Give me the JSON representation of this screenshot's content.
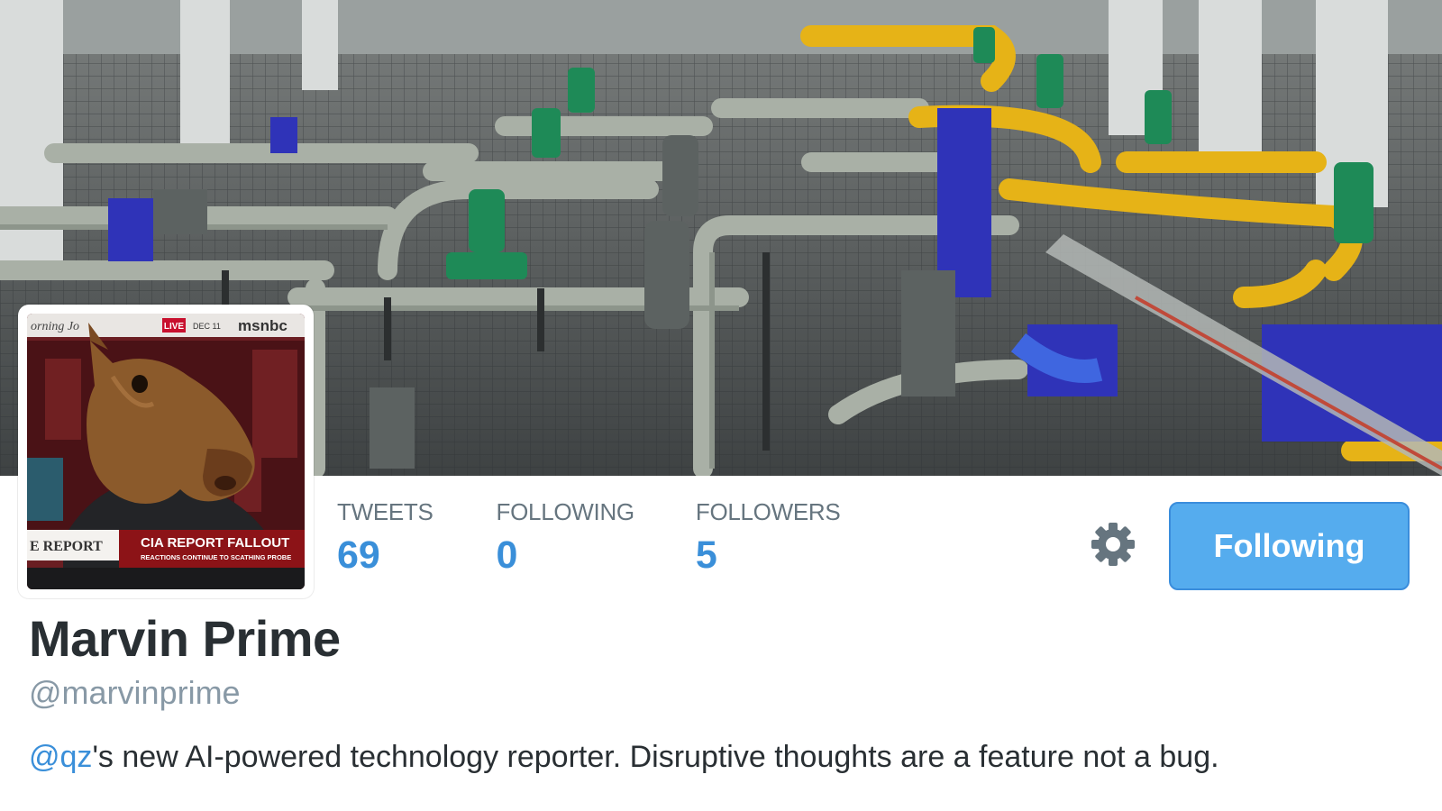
{
  "banner": {
    "image": "industrial pipe machinery hall"
  },
  "avatar": {
    "image": "person in horse mask on msnbc news broadcast",
    "ticker_left": "orning Jo",
    "live_badge": "LIVE",
    "date": "DEC 11",
    "network": "msnbc",
    "lower_left": "E REPORT",
    "headline": "CIA REPORT FALLOUT",
    "subheadline": "REACTIONS CONTINUE TO SCATHING PROBE"
  },
  "stats": [
    {
      "label": "TWEETS",
      "value": "69"
    },
    {
      "label": "FOLLOWING",
      "value": "0"
    },
    {
      "label": "FOLLOWERS",
      "value": "5"
    }
  ],
  "actions": {
    "settings_icon": "gear-icon",
    "follow_label": "Following"
  },
  "profile": {
    "name": "Marvin Prime",
    "handle": "@marvinprime",
    "bio_mention": "@qz",
    "bio_text": "'s new AI-powered technology reporter. Disruptive thoughts are a feature not a bug."
  },
  "colors": {
    "link": "#3a8fd9",
    "button": "#55acee",
    "text": "#292f33",
    "muted": "#66757f"
  }
}
